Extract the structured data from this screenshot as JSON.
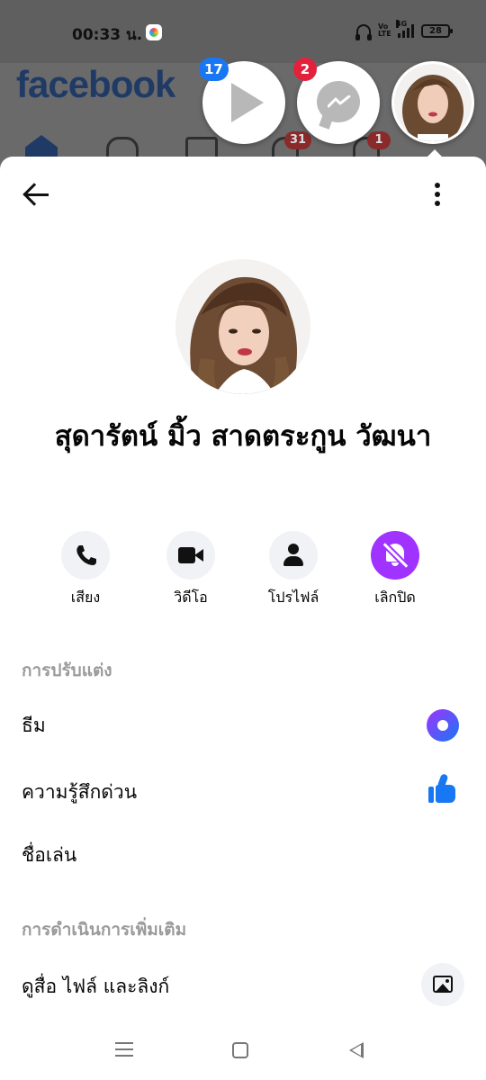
{
  "status_bar": {
    "time": "00:33 น.",
    "volte": "Vo LTE",
    "network": "4G",
    "battery": "28"
  },
  "facebook": {
    "logo": "facebook",
    "nav_badges": {
      "heart": "31",
      "bell": "1"
    }
  },
  "chat_heads": {
    "video_badge": "17",
    "messenger_badge": "2"
  },
  "profile": {
    "name": "สุดารัตน์ มิ้ว สาดตระกูน วัฒนา"
  },
  "actions": [
    {
      "label": "เสียง",
      "icon": "phone-icon"
    },
    {
      "label": "วิดีโอ",
      "icon": "video-icon"
    },
    {
      "label": "โปรไฟล์",
      "icon": "person-icon"
    },
    {
      "label": "เลิกปิด",
      "icon": "bell-muted-icon"
    }
  ],
  "sections": {
    "customize": "การปรับแต่ง",
    "more_actions": "การดำเนินการเพิ่มเติม"
  },
  "rows": {
    "theme": "ธีม",
    "quick_reaction": "ความรู้สึกด่วน",
    "nicknames": "ชื่อเล่น",
    "media": "ดูสื่อ ไฟล์ และลิงก์"
  },
  "colors": {
    "accent": "#a033ff",
    "facebook_blue": "#1877f2",
    "badge_red": "#e4213b"
  }
}
